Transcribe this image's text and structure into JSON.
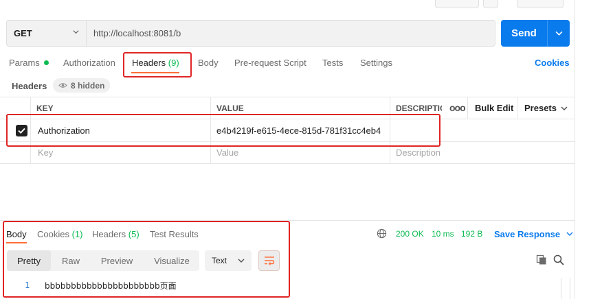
{
  "request": {
    "method": "GET",
    "url": "http://localhost:8081/b",
    "send_label": "Send"
  },
  "tabs": {
    "params": "Params",
    "authorization": "Authorization",
    "headers": "Headers",
    "headers_count": "(9)",
    "body": "Body",
    "prerequest": "Pre-request Script",
    "tests": "Tests",
    "settings": "Settings",
    "cookies": "Cookies"
  },
  "headers_section": {
    "label": "Headers",
    "hidden": "8 hidden"
  },
  "table": {
    "columns": {
      "key": "KEY",
      "value": "VALUE",
      "description": "DESCRIPTIO",
      "bulk_edit": "Bulk Edit",
      "presets": "Presets"
    },
    "more": "ooo",
    "rows": [
      {
        "checked": true,
        "key": "Authorization",
        "value": "e4b4219f-e615-4ece-815d-781f31cc4eb4",
        "description": ""
      }
    ],
    "placeholder": {
      "key": "Key",
      "value": "Value",
      "description": "Description"
    }
  },
  "response": {
    "tabs": {
      "body": "Body",
      "cookies": "Cookies",
      "cookies_count": "(1)",
      "headers": "Headers",
      "headers_count": "(5)",
      "test_results": "Test Results"
    },
    "status": "200 OK",
    "time": "10 ms",
    "size": "192 B",
    "save": "Save Response",
    "views": [
      "Pretty",
      "Raw",
      "Preview",
      "Visualize"
    ],
    "format": "Text",
    "line_number": "1",
    "content": "bbbbbbbbbbbbbbbbbbbbbb页面"
  },
  "colors": {
    "accent": "#ff6c37",
    "primary": "#097bed",
    "success": "#0cbb52",
    "highlight": "#e02424"
  }
}
